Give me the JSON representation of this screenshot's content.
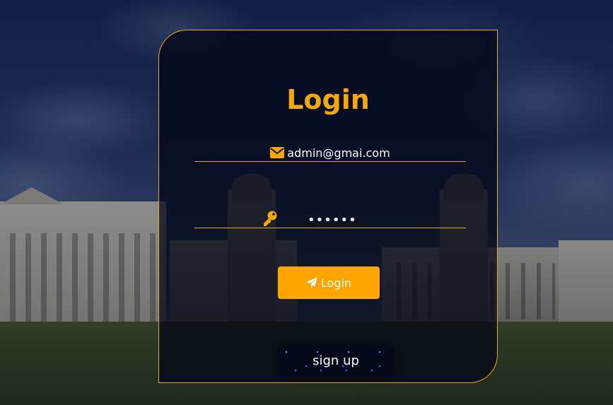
{
  "page": {
    "title": "Login"
  },
  "form": {
    "email_value": "admin@gmai.com",
    "password_value": "••••••",
    "login_label": "Login",
    "signup_label": "sign up"
  },
  "icons": {
    "email": "envelope-icon",
    "password": "key-icon",
    "login": "paper-plane-icon"
  },
  "colors": {
    "accent": "#ffa500",
    "title": "#f5a70f",
    "card_bg": "rgba(0,4,18,0.72)",
    "text": "#ffffff"
  }
}
